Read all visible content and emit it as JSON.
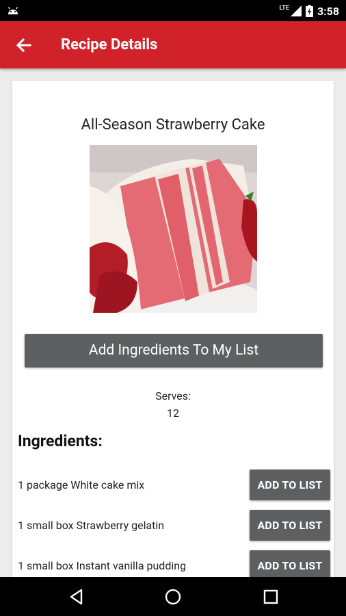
{
  "status_bar": {
    "time": "3:58",
    "network": "LTE"
  },
  "app_bar": {
    "title": "Recipe Details"
  },
  "recipe": {
    "title": "All-Season Strawberry Cake",
    "add_all_label": "Add Ingredients To My List",
    "serves_label": "Serves:",
    "serves_value": "12"
  },
  "ingredients": {
    "heading": "Ingredients:",
    "add_label": "ADD TO LIST",
    "items": [
      "1 package White cake mix",
      "1 small box Strawberry gelatin",
      "1 small box Instant vanilla pudding"
    ]
  },
  "colors": {
    "app_bar": "#d1222a",
    "button": "#5d5f60"
  }
}
